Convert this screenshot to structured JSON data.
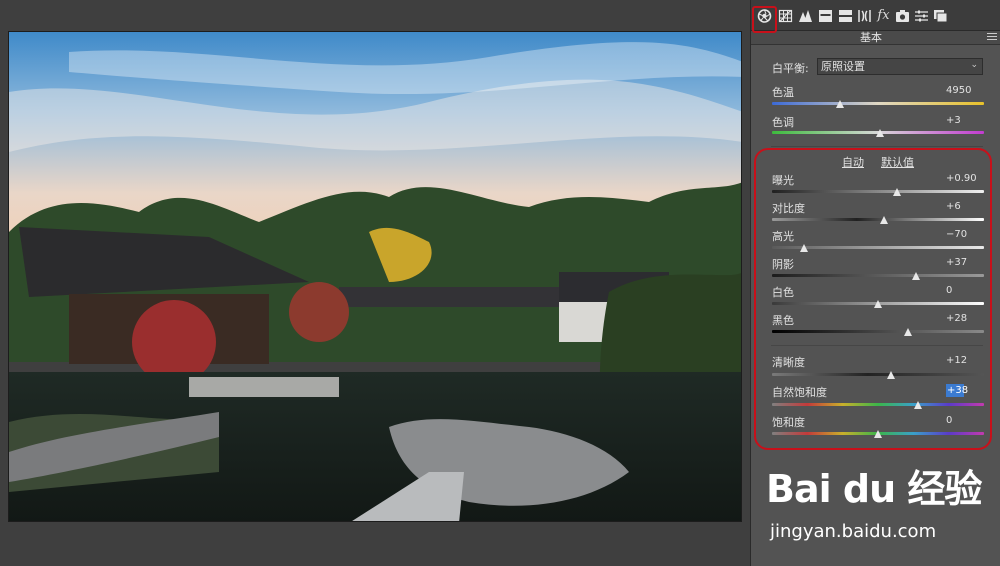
{
  "toolbar": {
    "icons": [
      "basic-aperture-icon",
      "tone-curve-grid-icon",
      "detail-triangle-icon",
      "hsl-icon",
      "split-toning-icon",
      "lens-corrections-icon",
      "effects-fx-icon",
      "camera-calibration-icon",
      "presets-sliders-icon",
      "snapshots-icon"
    ],
    "fx_text": "fx"
  },
  "panel": {
    "title": "基本",
    "white_balance": {
      "label": "白平衡:",
      "value": "原照设置"
    },
    "sliders_wb": [
      {
        "label": "色温",
        "value": "4950",
        "position": 0.32
      },
      {
        "label": "色调",
        "value": "+3",
        "position": 0.51
      }
    ],
    "auto_label": "自动",
    "default_label": "默认值",
    "sliders_tone": [
      {
        "label": "曝光",
        "value": "+0.90",
        "position": 0.59
      },
      {
        "label": "对比度",
        "value": "+6",
        "position": 0.53
      },
      {
        "label": "高光",
        "value": "−70",
        "position": 0.15
      },
      {
        "label": "阴影",
        "value": "+37",
        "position": 0.68
      },
      {
        "label": "白色",
        "value": "0",
        "position": 0.5
      },
      {
        "label": "黑色",
        "value": "+28",
        "position": 0.64
      }
    ],
    "sliders_presence": [
      {
        "label": "清晰度",
        "value": "+12",
        "position": 0.56
      },
      {
        "label": "自然饱和度",
        "value": "+38",
        "position": 0.69,
        "highlighted": true
      },
      {
        "label": "饱和度",
        "value": "0",
        "position": 0.5
      }
    ]
  },
  "watermark": {
    "logo": "Bai du 经验",
    "url": "jingyan.baidu.com"
  },
  "colors": {
    "annotation": "#c8101a",
    "panel_bg": "#535353",
    "highlight": "#3b7bd1"
  }
}
